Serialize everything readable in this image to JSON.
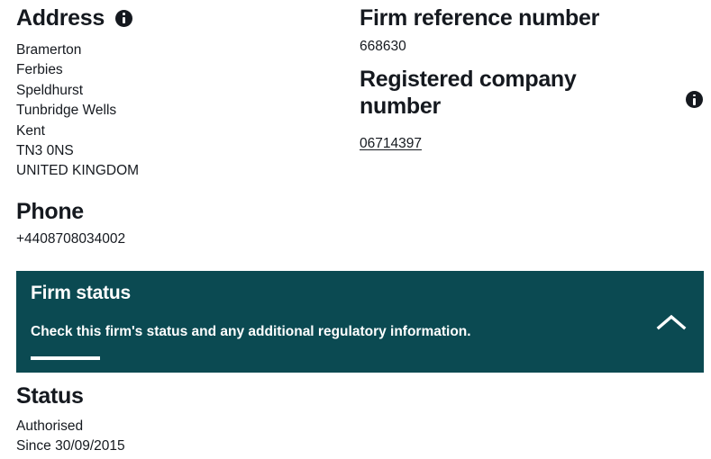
{
  "theme": {
    "background": "#ffffff",
    "text": "#15191f",
    "panel_teal": "#0b4a52",
    "panel_text": "#ffffff"
  },
  "address": {
    "heading": "Address",
    "info_icon": "info-icon",
    "lines": [
      "Bramerton",
      "Ferbies",
      "Speldhurst",
      "Tunbridge Wells",
      "Kent",
      "TN3 0NS",
      "UNITED KINGDOM"
    ]
  },
  "phone": {
    "heading": "Phone",
    "value": "+4408708034002"
  },
  "firm_reference": {
    "heading": "Firm reference number",
    "value": "668630"
  },
  "registered_company": {
    "heading": "Registered company number",
    "value": "06714397",
    "info_icon": "info-icon"
  },
  "firm_status_panel": {
    "title": "Firm status",
    "description": "Check this firm's status and any additional regulatory information.",
    "toggle_icon": "chevron-up-icon"
  },
  "status": {
    "heading": "Status",
    "value": "Authorised",
    "since": "Since 30/09/2015"
  }
}
